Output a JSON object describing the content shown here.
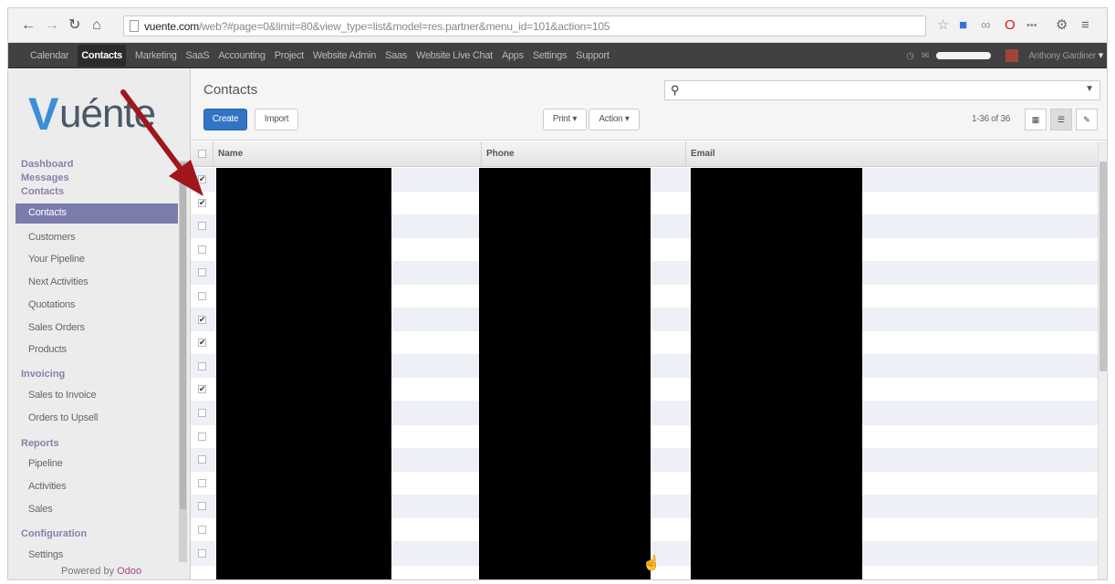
{
  "browser": {
    "url_host": "vuente.com",
    "url_rest": "/web?#page=0&limit=80&view_type=list&model=res.partner&menu_id=101&action=105"
  },
  "topmenu": {
    "items": [
      "Calendar",
      "Contacts",
      "Marketing",
      "SaaS",
      "Accounting",
      "Project",
      "Website Admin",
      "Saas",
      "Website Live Chat",
      "Apps",
      "Settings",
      "Support"
    ],
    "active": "Contacts",
    "user": "Anthony Gardiner"
  },
  "sidebar": {
    "logo_text": "uénte",
    "groups": {
      "dashboard": "Dashboard",
      "messages": "Messages",
      "contacts": "Contacts",
      "invoicing": "Invoicing",
      "reports": "Reports",
      "configuration": "Configuration"
    },
    "items": {
      "contacts": "Contacts",
      "customers": "Customers",
      "pipeline": "Your Pipeline",
      "next_activities": "Next Activities",
      "quotations": "Quotations",
      "sales_orders": "Sales Orders",
      "products": "Products",
      "sales_to_invoice": "Sales to Invoice",
      "orders_to_upsell": "Orders to Upsell",
      "rep_pipeline": "Pipeline",
      "activities": "Activities",
      "sales": "Sales",
      "settings": "Settings"
    },
    "powered_prefix": "Powered by ",
    "powered_brand": "Odoo"
  },
  "control_panel": {
    "breadcrumb": "Contacts",
    "create_label": "Create",
    "import_label": "Import",
    "print_label": "Print ▾",
    "action_label": "Action ▾",
    "pager": "1-36 of 36"
  },
  "table": {
    "columns": {
      "name": "Name",
      "phone": "Phone",
      "email": "Email"
    },
    "rows_checked": [
      true,
      true,
      false,
      false,
      false,
      false,
      true,
      true,
      false,
      true,
      false,
      false,
      false,
      false,
      false,
      false,
      false
    ]
  },
  "colors": {
    "accent": "#3274c3",
    "active_nav": "#7c7bad",
    "arrow": "#a0161b",
    "topbar": "#414141"
  }
}
